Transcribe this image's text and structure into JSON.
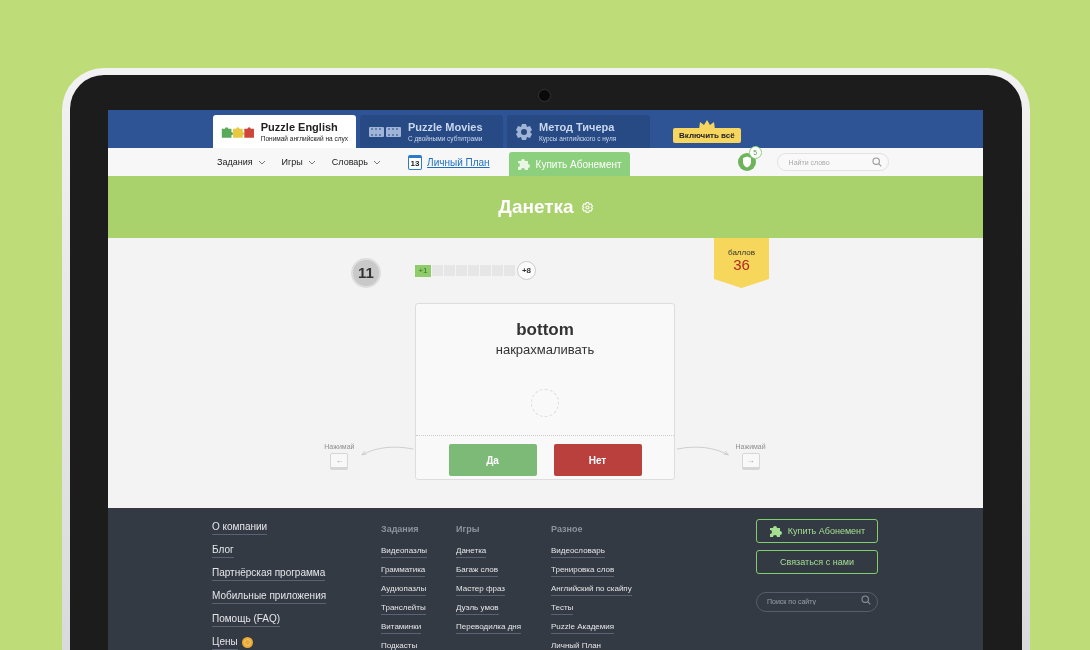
{
  "tabs": [
    {
      "title": "Puzzle English",
      "subtitle": "Понимай английский на слух",
      "selected": true,
      "kind": "english"
    },
    {
      "title": "Puzzle Movies",
      "subtitle": "С двойными субтитрами",
      "selected": false,
      "kind": "movies"
    },
    {
      "title": "Метод Тичера",
      "subtitle": "Курсы английского с нуля",
      "selected": false,
      "kind": "teacher"
    }
  ],
  "promo_button": "Включить всё",
  "nav": {
    "menus": [
      "Задания",
      "Игры",
      "Словарь"
    ],
    "plan": {
      "day": "13",
      "label": "Личный План"
    },
    "buy": "Купить Абонемент",
    "badge": "5",
    "search": {
      "placeholder": "Найти слово"
    }
  },
  "banner": {
    "title": "Данетка"
  },
  "game": {
    "timer": "11",
    "progress": [
      {
        "label": "+1",
        "done": true
      },
      {
        "done": false
      },
      {
        "done": false
      },
      {
        "done": false
      },
      {
        "done": false
      },
      {
        "done": false
      },
      {
        "done": false
      },
      {
        "done": false
      }
    ],
    "bonus": "+8",
    "score": {
      "label": "баллов",
      "value": "36"
    },
    "card": {
      "word": "bottom",
      "translation": "накрахмаливать"
    },
    "answers": [
      {
        "label": "Да",
        "kind": "yes"
      },
      {
        "label": "Нет",
        "kind": "no"
      }
    ],
    "hints": [
      {
        "text": "Нажимай",
        "key": "←",
        "kind": "left"
      },
      {
        "text": "Нажимай",
        "key": "→",
        "kind": "right"
      }
    ]
  },
  "footer": {
    "links": [
      "О компании",
      "Блог",
      "Партнёрская программа",
      "Мобильные приложения",
      "Помощь (FAQ)",
      "Цены"
    ],
    "columns": [
      {
        "heading": "Задания",
        "links": [
          "Видеопазлы",
          "Грамматика",
          "Аудиопазлы",
          "Транслейты",
          "Витаминки",
          "Подкасты"
        ]
      },
      {
        "heading": "Игры",
        "links": [
          "Данетка",
          "Багаж слов",
          "Мастер фраз",
          "Дуэль умов",
          "Переводилка дня"
        ]
      },
      {
        "heading": "Разное",
        "links": [
          "Видеословарь",
          "Тренировка слов",
          "Английский по скайпу",
          "Тесты",
          "Puzzle Академия",
          "Личный План"
        ]
      }
    ],
    "buttons": [
      {
        "label": "Купить Абонемент",
        "kind": "buy"
      },
      {
        "label": "Связаться с нами",
        "kind": "contact"
      }
    ],
    "search": {
      "placeholder": "Поиск по сайту"
    }
  }
}
